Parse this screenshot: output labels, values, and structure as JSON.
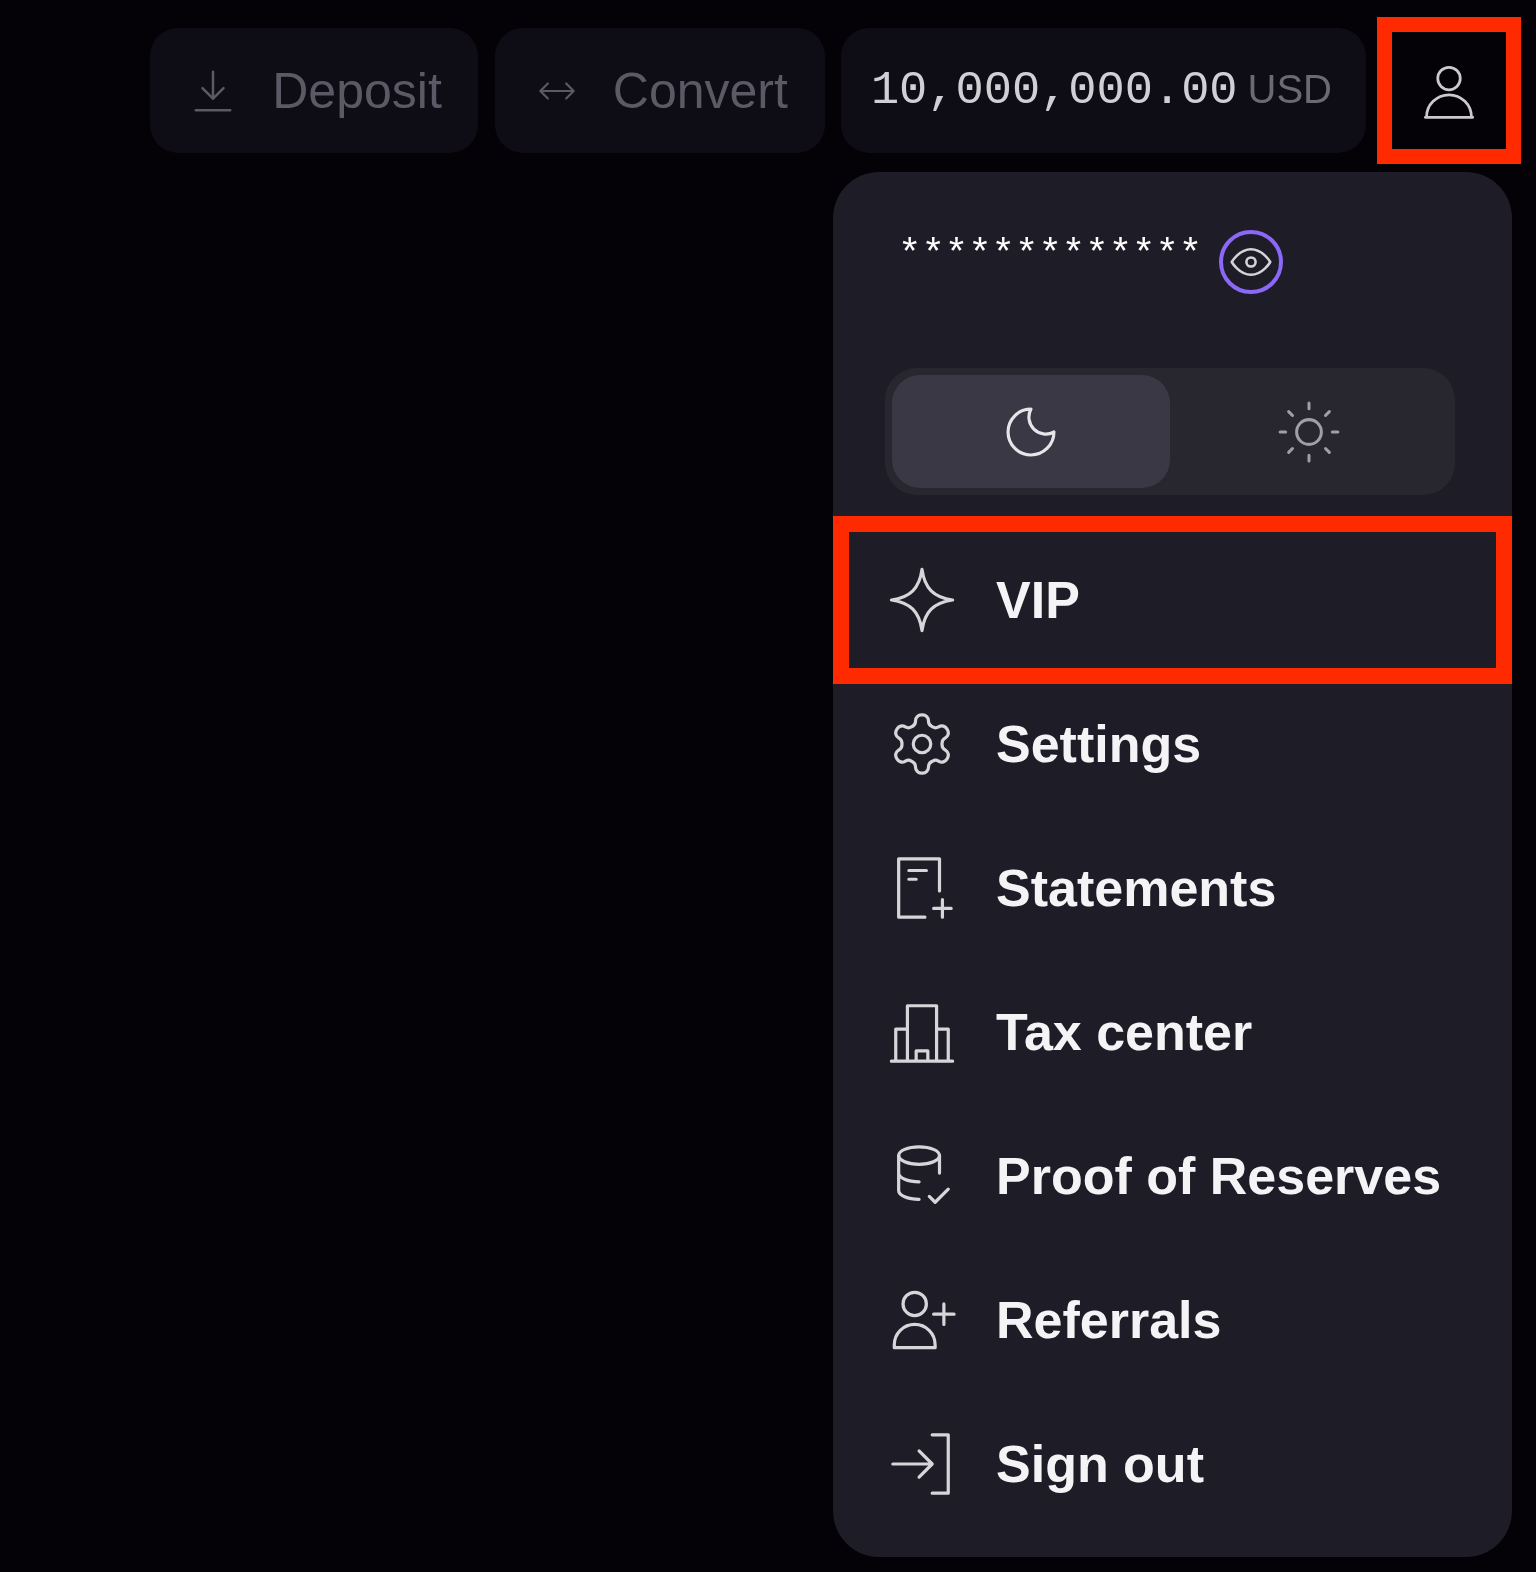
{
  "top_bar": {
    "buttons": [
      {
        "kind": "deposit",
        "label": "Deposit"
      },
      {
        "kind": "convert",
        "label": "Convert"
      }
    ],
    "balance": {
      "amount": "10,000,000.00",
      "currency": "USD"
    },
    "profile_button": {
      "highlighted": true
    }
  },
  "account_menu": {
    "masked_id": "*************",
    "reveal_button": {
      "focused": true
    },
    "theme_toggle": [
      {
        "kind": "dark",
        "selected": true
      },
      {
        "kind": "light",
        "selected": false
      }
    ],
    "items": [
      {
        "kind": "vip",
        "label": "VIP",
        "highlighted": true
      },
      {
        "kind": "settings",
        "label": "Settings",
        "highlighted": false
      },
      {
        "kind": "statements",
        "label": "Statements",
        "highlighted": false
      },
      {
        "kind": "tax",
        "label": "Tax center",
        "highlighted": false
      },
      {
        "kind": "reserves",
        "label": "Proof of Reserves",
        "highlighted": false
      },
      {
        "kind": "referrals",
        "label": "Referrals",
        "highlighted": false
      },
      {
        "kind": "signout",
        "label": "Sign out",
        "highlighted": false
      }
    ]
  }
}
